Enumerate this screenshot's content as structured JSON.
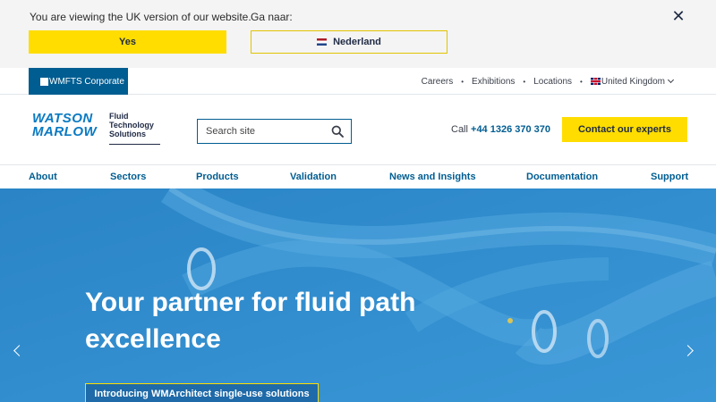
{
  "locale_banner": {
    "message": "You are viewing the UK version of our website.",
    "go_to_label": "Ga naar:",
    "yes_label": "Yes",
    "alt_locale_label": "Nederland",
    "close_symbol": "✕"
  },
  "utility_bar": {
    "corporate_label": "WMFTS Corporate",
    "links": [
      "Careers",
      "Exhibitions",
      "Locations"
    ],
    "separator": "•",
    "region_label": "United Kingdom"
  },
  "header": {
    "logo": {
      "brand_line1": "WATSON",
      "brand_line2": "MARLOW",
      "tagline1": "Fluid",
      "tagline2": "Technology",
      "tagline3": "Solutions"
    },
    "search_placeholder": "Search site",
    "call_prefix": "Call",
    "phone": "+44 1326 370 370",
    "contact_label": "Contact our experts"
  },
  "main_nav": {
    "items": [
      "About",
      "Sectors",
      "Products",
      "Validation",
      "News and Insights",
      "Documentation",
      "Support"
    ]
  },
  "hero": {
    "title_line1": "Your partner for fluid path",
    "title_line2": "excellence",
    "cta_label": "Introducing WMArchitect single-use solutions"
  },
  "colors": {
    "brand_blue": "#005d91",
    "accent_yellow": "#ffdd00",
    "hero_blue": "#2f8cce"
  }
}
